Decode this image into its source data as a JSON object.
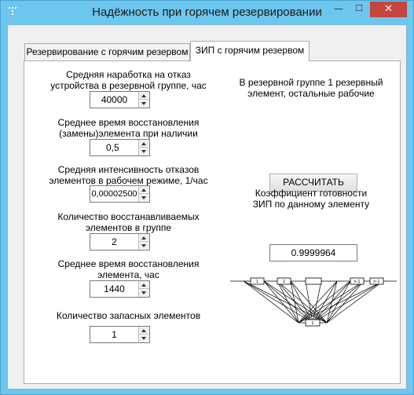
{
  "window": {
    "title": "Надёжность при горячем резервировании",
    "minimize": "—",
    "maximize": "☐",
    "close": "✕"
  },
  "tabs": [
    {
      "label": "Резервирование с горячим резервом",
      "active": false
    },
    {
      "label": "ЗИП с горячим резервом",
      "active": true
    }
  ],
  "fields": {
    "mtbf": {
      "label": "Средняя наработка на отказ\nустройства в резервной группе, час",
      "value": "40000"
    },
    "restore_time": {
      "label": "Среднее время восстановления\n(замены)элемента при наличии ЗИП,час",
      "value": "0,5"
    },
    "failure_rate": {
      "label": "Средняя интенсивность отказов\nэлементов в рабочем режиме, 1/час",
      "value": "0,00002500"
    },
    "restorable_count": {
      "label": "Количество восстанавливаемых\nэлементов в группе",
      "value": "2"
    },
    "element_restore_time": {
      "label": "Среднее время восстановления\nэлемента, час",
      "value": "1440"
    },
    "spare_count": {
      "label": "Количество запасных элементов",
      "value": "1"
    }
  },
  "info_text": "В резервной группе 1 резервный\nэлемент, остальные рабочие",
  "calculate_button": "РАССЧИТАТЬ",
  "result": {
    "label": "Коэффициент готовности\nЗИП по данному элементу",
    "value": "0.9999964"
  },
  "diagram": {
    "top_labels": [
      "1",
      "2",
      "",
      "n-1",
      "n-1"
    ],
    "bottom_label": "1"
  },
  "colors": {
    "title_bar": "#6cc6ee",
    "close_button": "#c7453c",
    "panel_background": "#f0f0f0",
    "tab_page_background": "#ffffff"
  }
}
